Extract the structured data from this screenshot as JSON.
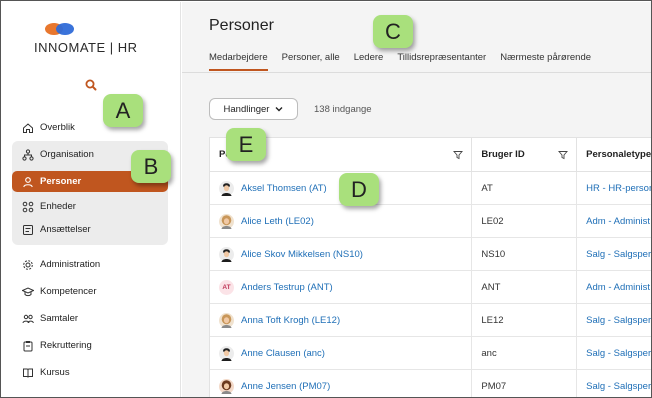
{
  "brand": {
    "logo_text": "INNOMATE | HR",
    "accent": "#c0561f",
    "logo_blue": "#2f6bd8",
    "logo_orange": "#e8772e"
  },
  "sidebar": {
    "search_icon": "search-icon",
    "items": [
      {
        "label": "Overblik",
        "icon": "home-icon"
      },
      {
        "label": "Organisation",
        "icon": "org-chart-icon"
      },
      {
        "label": "Personer",
        "icon": "person-icon"
      },
      {
        "label": "Enheder",
        "icon": "units-icon"
      },
      {
        "label": "Ansættelser",
        "icon": "id-card-icon"
      },
      {
        "label": "Administration",
        "icon": "gear-icon"
      },
      {
        "label": "Kompetencer",
        "icon": "graduation-cap-icon"
      },
      {
        "label": "Samtaler",
        "icon": "people-icon"
      },
      {
        "label": "Rekruttering",
        "icon": "clipboard-icon"
      },
      {
        "label": "Kursus",
        "icon": "book-icon"
      }
    ]
  },
  "header": {
    "title": "Personer",
    "tabs": [
      "Medarbejdere",
      "Personer, alle",
      "Ledere",
      "Tillidsrepræsentanter",
      "Nærmeste pårørende"
    ]
  },
  "toolbar": {
    "actions_label": "Handlinger",
    "count_text": "138 indgange"
  },
  "table": {
    "columns": [
      "Person",
      "Bruger ID",
      "Personaletype"
    ],
    "rows": [
      {
        "name": "Aksel Thomsen (AT)",
        "user_id": "AT",
        "type": "HR - HR-person",
        "avatar": "dark"
      },
      {
        "name": "Alice Leth (LE02)",
        "user_id": "LE02",
        "type": "Adm - Administ",
        "avatar": "blond"
      },
      {
        "name": "Alice Skov Mikkelsen (NS10)",
        "user_id": "NS10",
        "type": "Salg - Salgspers",
        "avatar": "dark"
      },
      {
        "name": "Anders Testrup (ANT)",
        "user_id": "ANT",
        "type": "Adm - Administ",
        "avatar": "initials",
        "initials": "AT"
      },
      {
        "name": "Anna Toft Krogh (LE12)",
        "user_id": "LE12",
        "type": "Salg - Salgspers",
        "avatar": "blond"
      },
      {
        "name": "Anne Clausen (anc)",
        "user_id": "anc",
        "type": "Salg - Salgspers",
        "avatar": "dark"
      },
      {
        "name": "Anne Jensen (PM07)",
        "user_id": "PM07",
        "type": "Salg - Salgspers",
        "avatar": "woman"
      }
    ]
  },
  "markers": [
    "A",
    "B",
    "C",
    "D",
    "E"
  ]
}
